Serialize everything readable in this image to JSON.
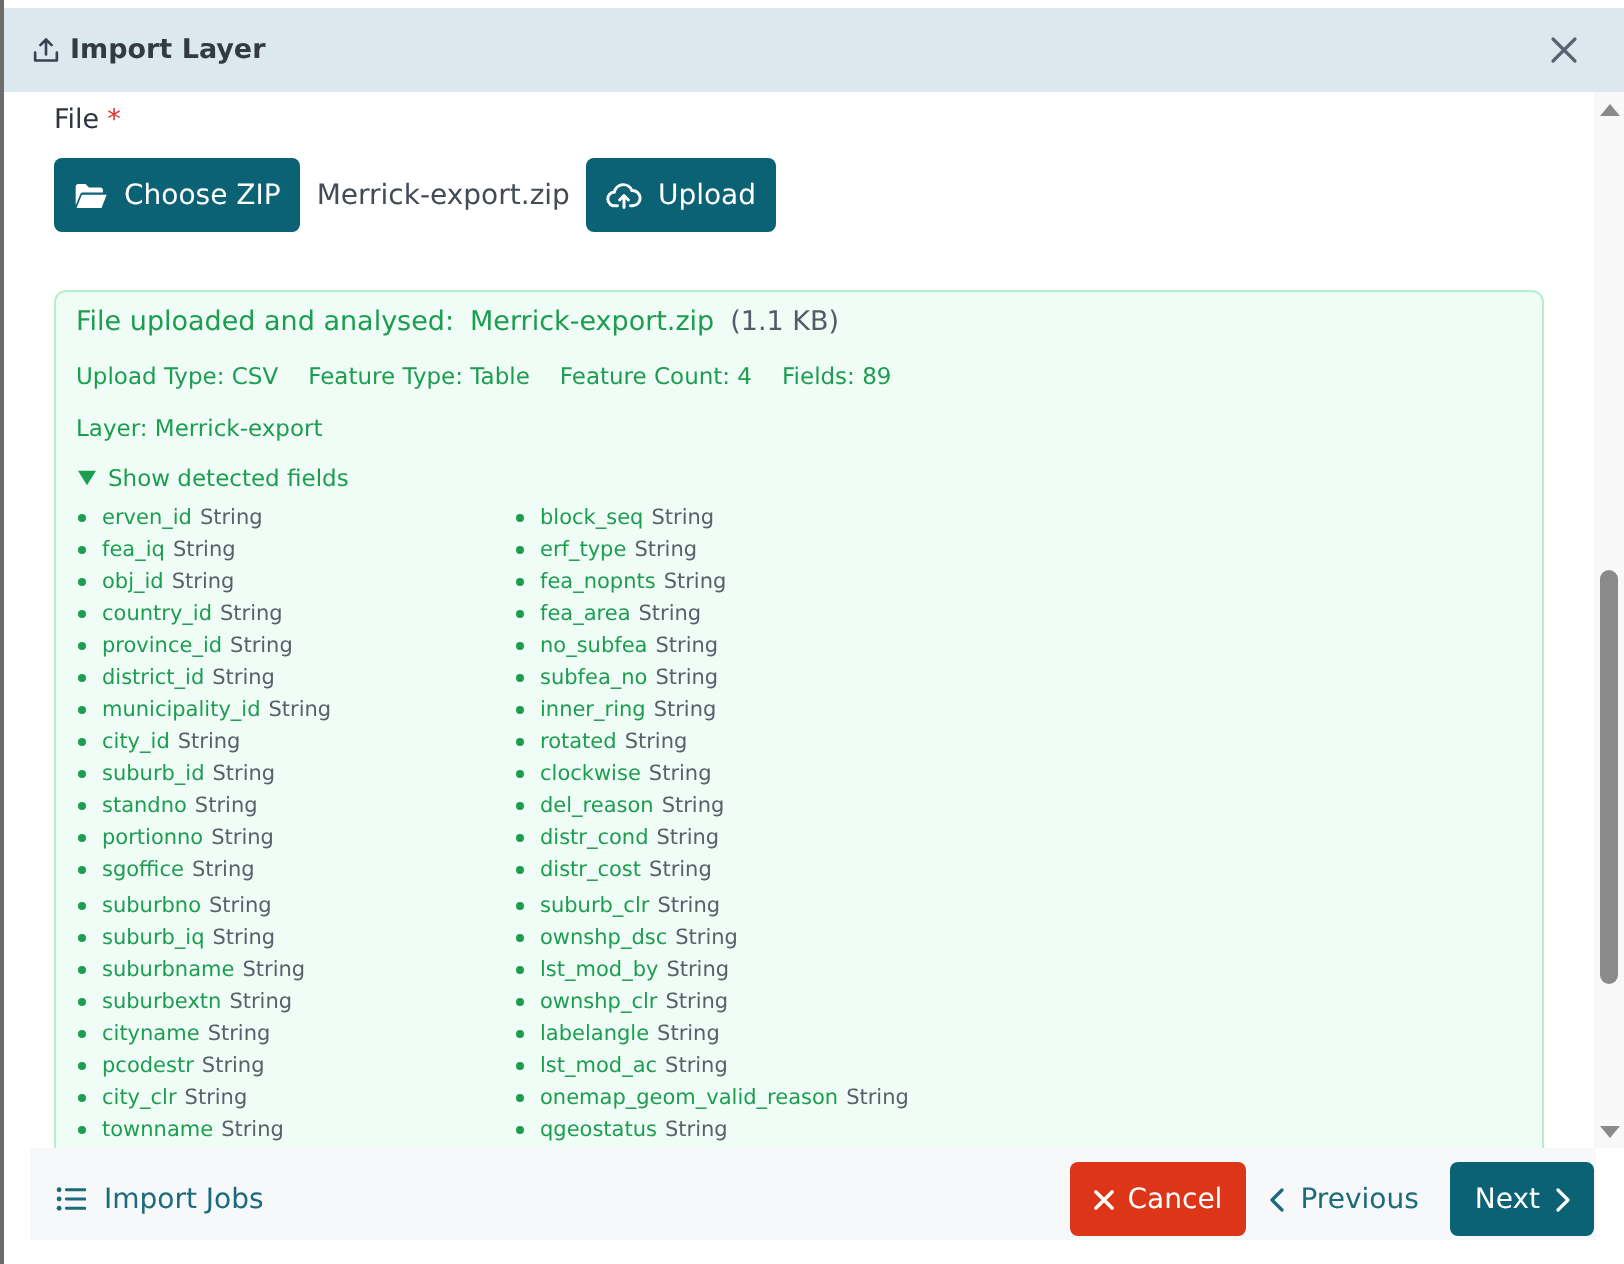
{
  "window": {
    "title": "Import Layer"
  },
  "file_field": {
    "label": "File",
    "required_mark": "*",
    "choose_button": "Choose ZIP",
    "file_name": "Merrick-export.zip",
    "upload_button": "Upload"
  },
  "result": {
    "title": "File uploaded and analysed:",
    "file_name": "Merrick-export.zip",
    "size": "(1.1 KB)",
    "meta": [
      "Upload Type: CSV",
      "Feature Type: Table",
      "Feature Count: 4",
      "Fields: 89"
    ],
    "layer": "Layer: Merrick-export",
    "toggle": {
      "label": "Show detected fields",
      "expanded": true
    },
    "field_groups": [
      {
        "fields": [
          {
            "name": "erven_id",
            "type": "String"
          },
          {
            "name": "fea_iq",
            "type": "String"
          },
          {
            "name": "obj_id",
            "type": "String"
          },
          {
            "name": "country_id",
            "type": "String"
          },
          {
            "name": "province_id",
            "type": "String"
          },
          {
            "name": "district_id",
            "type": "String"
          },
          {
            "name": "municipality_id",
            "type": "String"
          },
          {
            "name": "city_id",
            "type": "String"
          },
          {
            "name": "suburb_id",
            "type": "String"
          },
          {
            "name": "standno",
            "type": "String"
          },
          {
            "name": "portionno",
            "type": "String"
          },
          {
            "name": "sgoffice",
            "type": "String"
          },
          {
            "name": "block_seq",
            "type": "String"
          },
          {
            "name": "erf_type",
            "type": "String"
          },
          {
            "name": "fea_nopnts",
            "type": "String"
          },
          {
            "name": "fea_area",
            "type": "String"
          },
          {
            "name": "no_subfea",
            "type": "String"
          },
          {
            "name": "subfea_no",
            "type": "String"
          },
          {
            "name": "inner_ring",
            "type": "String"
          },
          {
            "name": "rotated",
            "type": "String"
          },
          {
            "name": "clockwise",
            "type": "String"
          },
          {
            "name": "del_reason",
            "type": "String"
          },
          {
            "name": "distr_cond",
            "type": "String"
          },
          {
            "name": "distr_cost",
            "type": "String"
          }
        ]
      },
      {
        "fields": [
          {
            "name": "suburbno",
            "type": "String"
          },
          {
            "name": "suburb_iq",
            "type": "String"
          },
          {
            "name": "suburbname",
            "type": "String"
          },
          {
            "name": "suburbextn",
            "type": "String"
          },
          {
            "name": "cityname",
            "type": "String"
          },
          {
            "name": "pcodestr",
            "type": "String"
          },
          {
            "name": "city_clr",
            "type": "String"
          },
          {
            "name": "townname",
            "type": "String"
          },
          {
            "name": "suburb_clr",
            "type": "String"
          },
          {
            "name": "ownshp_dsc",
            "type": "String"
          },
          {
            "name": "lst_mod_by",
            "type": "String"
          },
          {
            "name": "ownshp_clr",
            "type": "String"
          },
          {
            "name": "labelangle",
            "type": "String"
          },
          {
            "name": "lst_mod_ac",
            "type": "String"
          },
          {
            "name": "onemap_geom_valid_reason",
            "type": "String"
          },
          {
            "name": "qgeostatus",
            "type": "String"
          }
        ]
      }
    ]
  },
  "footer": {
    "jobs_link": "Import Jobs",
    "buttons": [
      {
        "kind": "cancel",
        "label": "Cancel"
      },
      {
        "kind": "previous",
        "label": "Previous"
      },
      {
        "kind": "next",
        "label": "Next"
      }
    ]
  }
}
